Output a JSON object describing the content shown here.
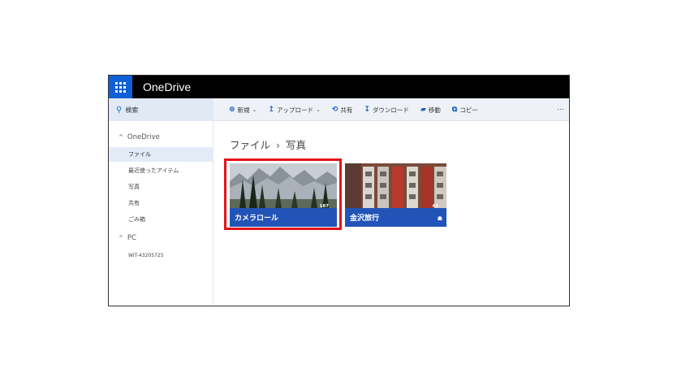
{
  "titlebar": {
    "app_title": "OneDrive"
  },
  "commandbar": {
    "search_label": "検索",
    "commands": [
      {
        "label": "新規",
        "icon": "plus-circle-icon",
        "dropdown": true
      },
      {
        "label": "アップロード",
        "icon": "upload-arrow-icon",
        "dropdown": true
      },
      {
        "label": "共有",
        "icon": "share-icon",
        "dropdown": false
      },
      {
        "label": "ダウンロード",
        "icon": "download-arrow-icon",
        "dropdown": false
      },
      {
        "label": "移動",
        "icon": "move-icon",
        "dropdown": false
      },
      {
        "label": "コピー",
        "icon": "copy-icon",
        "dropdown": false
      }
    ],
    "more_label": "..."
  },
  "sidebar": {
    "onedrive_header": "OneDrive",
    "items": [
      "ファイル",
      "最近使ったアイテム",
      "写真",
      "共有",
      "ごみ箱"
    ],
    "active_index": 0,
    "pc_header": "PC",
    "pc_items": [
      "WIT-43205725"
    ]
  },
  "breadcrumb": {
    "root": "ファイル",
    "separator": "›",
    "current": "写真"
  },
  "tiles": [
    {
      "name": "カメラロール",
      "count": "187",
      "selected": true,
      "icon": "mountain-forest-photo"
    },
    {
      "name": "金沢旅行",
      "count": "43",
      "selected": false,
      "icon": "building-photo",
      "shared": true
    }
  ],
  "colors": {
    "brand_blue": "#0f5fd6",
    "tile_bar": "#2254b8",
    "highlight_red": "#e3141b",
    "titlebar": "#000000"
  }
}
